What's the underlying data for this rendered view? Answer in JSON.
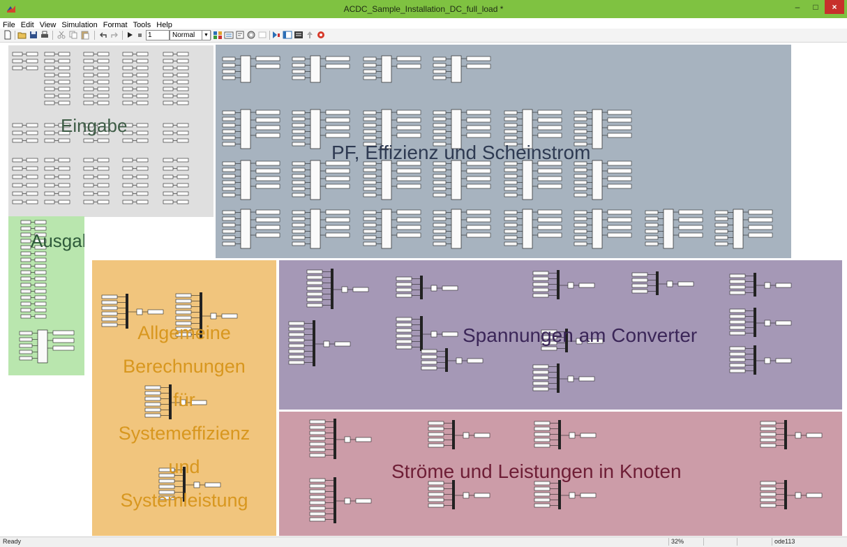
{
  "window": {
    "title": "ACDC_Sample_Installation_DC_full_load *",
    "controls": {
      "minimize": "–",
      "maximize": "□",
      "close": "×"
    },
    "titlebar_color": "#7fc241"
  },
  "menu": [
    "File",
    "Edit",
    "View",
    "Simulation",
    "Format",
    "Tools",
    "Help"
  ],
  "toolbar": {
    "icons": [
      "new-icon",
      "open-icon",
      "save-icon",
      "print-icon",
      "cut-icon",
      "copy-icon",
      "paste-icon",
      "undo-icon",
      "redo-icon",
      "start-icon",
      "stop-icon",
      "library-browser-icon",
      "model-explorer-icon",
      "debug-icon",
      "build-icon",
      "update-diagram-icon",
      "zoom-icon",
      "navigate-up-icon",
      "settings-icon"
    ],
    "stop_time": "1",
    "simulation_mode": "Normal"
  },
  "areas": {
    "eingabe": {
      "label": "Eingabe",
      "color": "#dfdfdf"
    },
    "pf": {
      "label": "PF, Effizienz und Scheinstrom",
      "color": "#a7b3bf"
    },
    "ausgabe": {
      "label": "Ausgabe",
      "color": "#b9e6ae"
    },
    "allgemeine": {
      "label": [
        "Allgemeine",
        "Berechnungen",
        "für",
        "Systemeffizienz",
        "und",
        "Systemleistung"
      ],
      "color": "#f1c57d"
    },
    "spannungen": {
      "label": "Spannungen am Converter",
      "color": "#a598b6"
    },
    "stroeme": {
      "label": "Ströme und Leistungen in Knoten",
      "color": "#cc9ca8"
    }
  },
  "status": {
    "text": "Ready",
    "zoom": "32%",
    "solver": "ode113"
  }
}
